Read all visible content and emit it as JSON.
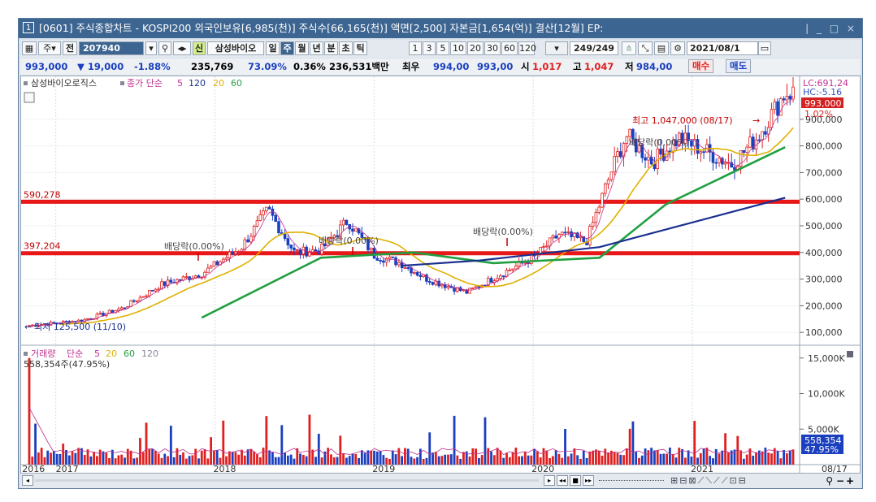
{
  "title_bar": {
    "icon": "1",
    "text": "[0601] 주식종합차트 - KOSPI200 외국인보유[6,985(천)] 주식수[66,165(천)] 액면[2,500] 자본금[1,654(억)] 결산[12월] EP:",
    "window_controls": "| _ □ ×"
  },
  "toolbar": {
    "market_label": "주",
    "whole_label": "전",
    "code": "207940",
    "new_badge": "신",
    "stock_name": "삼성바이오",
    "periods": [
      "일",
      "주",
      "월",
      "년",
      "분",
      "초",
      "틱"
    ],
    "selected_period": "주",
    "intervals": [
      "1",
      "3",
      "5",
      "10",
      "20",
      "30",
      "60",
      "120"
    ],
    "count_value": "249",
    "count_total": "/249",
    "date": "2021/08/1"
  },
  "price_bar": {
    "price": "993,000",
    "change": "▼ 19,000",
    "change_rate": "-1.88%",
    "volume": "235,769",
    "ratio": "73.09%",
    "turnover": "0.36%",
    "amount": "236,531백만",
    "quote_label": "최우",
    "ask": "994,00",
    "bid": "993,00",
    "open_label": "시",
    "open": "1,017",
    "high_label": "고",
    "high": "1,047",
    "low_label": "저",
    "low": "984,00",
    "buy_label": "매수",
    "sell_label": "매도"
  },
  "price_panel": {
    "legend_stock": "삼성바이오로직스",
    "legend_ma": "종가 단순",
    "legend_periods": [
      "5",
      "120",
      "20",
      "60"
    ],
    "lc_label": "LC:691,24",
    "hc_label": "HC:-5.16",
    "current_price_label": "993,000",
    "current_rate_label": "1.02%",
    "max_label": "최고 1,047,000 (08/17)",
    "min_label": "최저 125,500 (11/10)",
    "line1_label": "590,278",
    "line2_label": "397,204",
    "dividend_labels": [
      "배당락(0.00%)",
      "배당락(0.00%)",
      "배당락(0.00%)",
      "배당락(0.00%)"
    ]
  },
  "volume_panel": {
    "legend_title": "거래량",
    "legend_ma": "단순",
    "legend_periods": [
      "5",
      "20",
      "60",
      "120"
    ],
    "max_label": "558,354주(47.95%)",
    "current_volume_label": "558,354",
    "current_ratio_label": "47.95%"
  },
  "x_axis_labels": [
    "2016",
    "2017",
    "2018",
    "2019",
    "2020",
    "2021",
    "08/17"
  ],
  "colors": {
    "up": "#e02020",
    "down": "#1a3fbf",
    "ma5": "#c03090",
    "ma20": "#e0b000",
    "ma60": "#20a040",
    "ma120": "#1a2f90",
    "support_line": "#e81818",
    "title_bar": "#3d6591"
  },
  "chart_data": {
    "type": "candlestick",
    "y_ticks": [
      900000,
      800000,
      700000,
      600000,
      500000,
      400000,
      300000,
      200000,
      100000
    ],
    "volume_y_ticks": [
      "15,000K",
      "10,000K",
      "5,000K"
    ],
    "horizontal_lines": [
      590278,
      397204
    ],
    "price_anchors": [
      [
        "2016-11",
        125500
      ],
      [
        "2017-03",
        145000
      ],
      [
        "2017-06",
        190000
      ],
      [
        "2017-09",
        280000
      ],
      [
        "2017-12",
        320000
      ],
      [
        "2018-03",
        420000
      ],
      [
        "2018-05",
        560000
      ],
      [
        "2018-07",
        400000
      ],
      [
        "2018-09",
        410000
      ],
      [
        "2018-11",
        520000
      ],
      [
        "2019-01",
        390000
      ],
      [
        "2019-03",
        360000
      ],
      [
        "2019-05",
        300000
      ],
      [
        "2019-08",
        250000
      ],
      [
        "2019-11",
        330000
      ],
      [
        "2020-01",
        380000
      ],
      [
        "2020-03",
        470000
      ],
      [
        "2020-05",
        440000
      ],
      [
        "2020-07",
        720000
      ],
      [
        "2020-08",
        840000
      ],
      [
        "2020-10",
        740000
      ],
      [
        "2020-12",
        830000
      ],
      [
        "2021-02",
        780000
      ],
      [
        "2021-04",
        730000
      ],
      [
        "2021-06",
        840000
      ],
      [
        "2021-08",
        1000000
      ]
    ],
    "ma120_anchors": [
      [
        "2019-03",
        350000
      ],
      [
        "2019-09",
        370000
      ],
      [
        "2020-06",
        420000
      ],
      [
        "2021-08",
        605000
      ]
    ],
    "ma60_anchors": [
      [
        "2017-12",
        155000
      ],
      [
        "2018-09",
        380000
      ],
      [
        "2019-04",
        400000
      ],
      [
        "2019-10",
        360000
      ],
      [
        "2020-06",
        380000
      ],
      [
        "2020-11",
        580000
      ],
      [
        "2021-08",
        795000
      ]
    ]
  }
}
